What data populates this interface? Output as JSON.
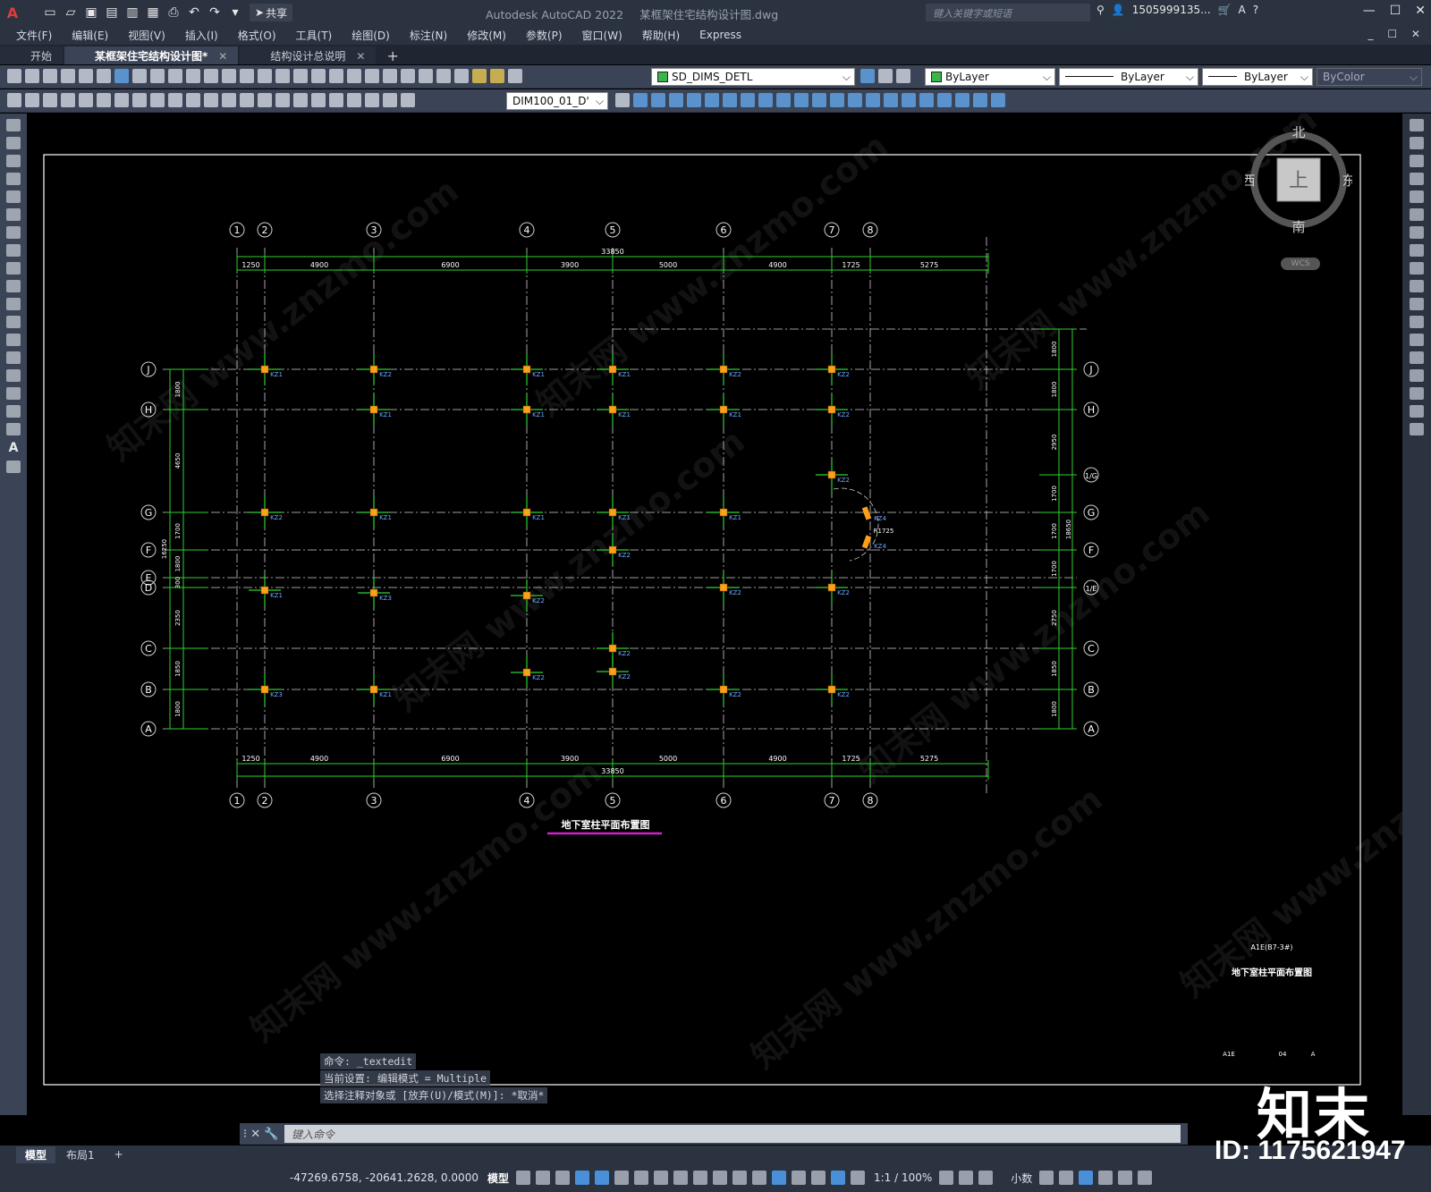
{
  "app": {
    "logo": "A",
    "share_label": "共享",
    "title": "Autodesk AutoCAD 2022",
    "filename": "某框架住宅结构设计图.dwg",
    "search_placeholder": "键入关键字或短语",
    "user": "1505999135...",
    "win_min": "—",
    "win_max": "☐",
    "win_close": "✕"
  },
  "menu": [
    "文件(F)",
    "编辑(E)",
    "视图(V)",
    "插入(I)",
    "格式(O)",
    "工具(T)",
    "绘图(D)",
    "标注(N)",
    "修改(M)",
    "参数(P)",
    "窗口(W)",
    "帮助(H)",
    "Express"
  ],
  "menu_right_controls": "_ ☐ ✕",
  "tabs": [
    {
      "label": "开始",
      "active": false,
      "closable": false
    },
    {
      "label": "某框架住宅结构设计图*",
      "active": true,
      "closable": true
    },
    {
      "label": "结构设计总说明",
      "active": false,
      "closable": true
    }
  ],
  "toolbar": {
    "layer": "SD_DIMS_DETL",
    "color": "ByLayer",
    "linetype": "ByLayer",
    "lineweight": "ByLayer",
    "plotstyle": "ByColor",
    "dimstyle": "DIM100_01_D'"
  },
  "viewcube": {
    "north": "北",
    "south": "南",
    "west": "西",
    "east": "东",
    "face": "上",
    "wcs": "WCS"
  },
  "drawing": {
    "col_axes_top": [
      "1",
      "2",
      "3",
      "4",
      "5",
      "6",
      "7",
      "8"
    ],
    "row_axes": [
      "J",
      "H",
      "G",
      "F",
      "E",
      "D",
      "C",
      "B",
      "A"
    ],
    "right_axes": [
      "J",
      "H",
      "1/G",
      "G",
      "F",
      "1/E",
      "C",
      "B",
      "A"
    ],
    "total_width": "33850",
    "top_dims": [
      "1250",
      "4900",
      "6900",
      "3900",
      "5000",
      "4900",
      "1725",
      "5275"
    ],
    "left_dims": [
      "1800",
      "4650",
      "1700",
      "1800",
      "300",
      "2350",
      "1850",
      "1800"
    ],
    "left_total": "16250",
    "right_dims": [
      "1800",
      "1800",
      "2950",
      "1700",
      "1700",
      "1700",
      "2750",
      "1850",
      "1800"
    ],
    "right_total": "18650",
    "column_labels": [
      "KZ1",
      "KZ2",
      "KZ3",
      "KZ4"
    ],
    "plan_title": "地下室柱平面布置图",
    "sheet_code": "A1E(B7-3#)",
    "sheet_title": "地下室柱平面布置图",
    "tb_a": "A1E",
    "tb_b": "04",
    "tb_c": "A",
    "radius_label": "R1725"
  },
  "command": {
    "log": [
      "命令: _textedit",
      "当前设置: 编辑模式 = Multiple",
      "选择注释对象或 [放弃(U)/模式(M)]: *取消*"
    ],
    "placeholder": "键入命令"
  },
  "layout_tabs": [
    {
      "label": "模型",
      "active": true
    },
    {
      "label": "布局1",
      "active": false
    }
  ],
  "status": {
    "coords": "-47269.6758, -20641.2628, 0.0000",
    "model": "模型",
    "scale": "1:1 / 100%",
    "units": "小数"
  },
  "watermark": {
    "brand": "知末",
    "id": "ID: 1175621947",
    "text": "知末网 www.znzmo.com"
  }
}
